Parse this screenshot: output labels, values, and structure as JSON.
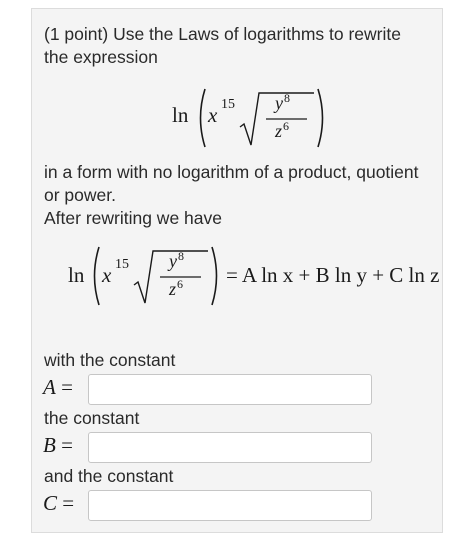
{
  "problem": {
    "points_label": "(1 point)",
    "instruction_line1": "Use the Laws of logarithms to rewrite",
    "instruction_line2": "the expression",
    "form_line1": "in a form with no logarithm of a product, quotient",
    "form_line2": "or power.",
    "after_text": "After rewriting we have"
  },
  "expression": {
    "ln": "ln",
    "base": "x",
    "base_exponent": "15",
    "numerator_var": "y",
    "numerator_exp": "8",
    "denominator_var": "z",
    "denominator_exp": "6"
  },
  "equation": {
    "rhs": "= A ln x + B ln y + C ln z"
  },
  "answers": [
    {
      "label_text": "with the constant",
      "symbol": "A",
      "equals": "=",
      "value": ""
    },
    {
      "label_text": "the constant",
      "symbol": "B",
      "equals": "=",
      "value": ""
    },
    {
      "label_text": "and the constant",
      "symbol": "C",
      "equals": "=",
      "value": ""
    }
  ]
}
